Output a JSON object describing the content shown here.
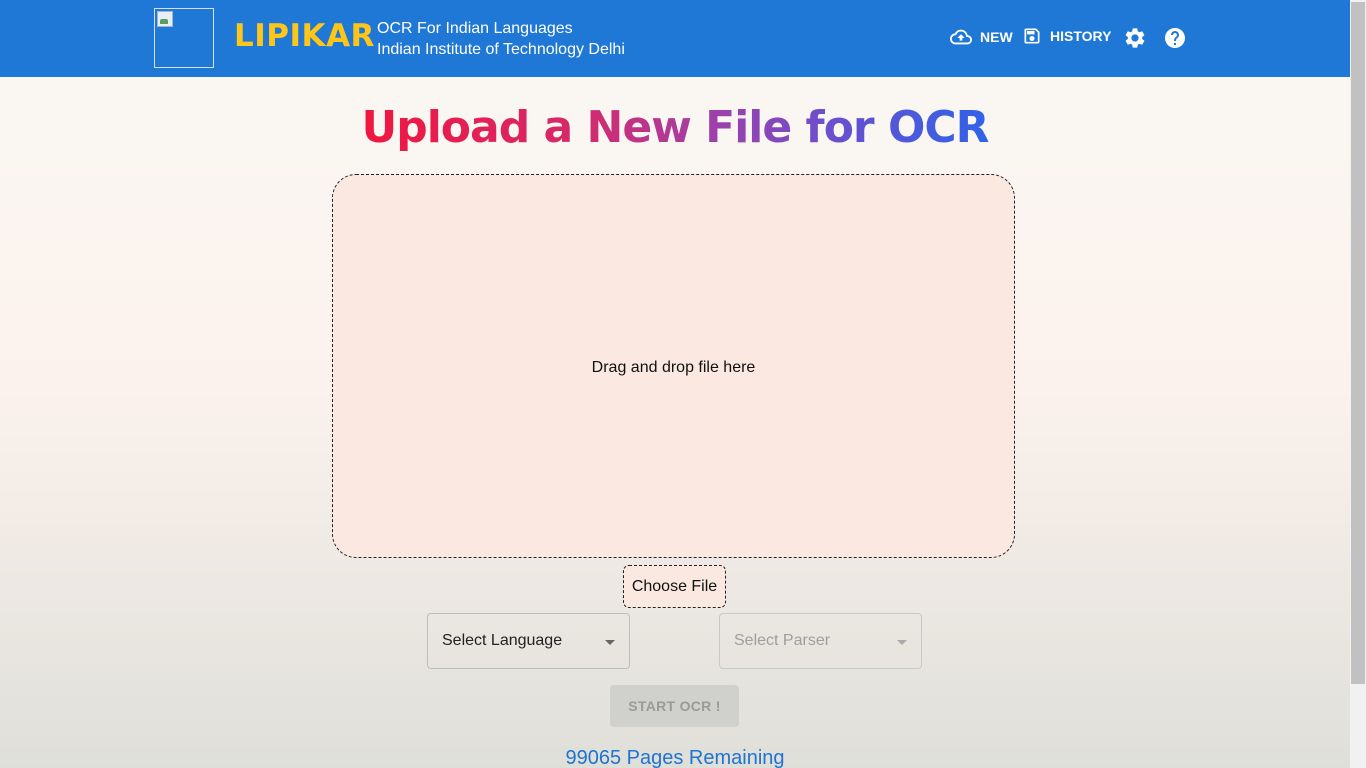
{
  "header": {
    "brand": "LIPIKAR",
    "subtitle_line1": "OCR For Indian Languages",
    "subtitle_line2": "Indian Institute of Technology Delhi",
    "nav": {
      "new_label": "NEW",
      "history_label": "HISTORY"
    },
    "icons": {
      "new": "cloud-upload-icon",
      "history": "save-icon",
      "settings": "gear-icon",
      "help": "help-icon"
    },
    "color": "#1f77d6",
    "brand_color": "#ffc61a"
  },
  "main": {
    "title": "Upload a New File for OCR",
    "dropzone_text": "Drag and drop file here",
    "choose_file_label": "Choose File",
    "language_select": {
      "value": "Select Language"
    },
    "parser_select": {
      "value": "Select Parser"
    },
    "start_button_label": "START OCR !",
    "pages_remaining": "99065 Pages Remaining"
  }
}
